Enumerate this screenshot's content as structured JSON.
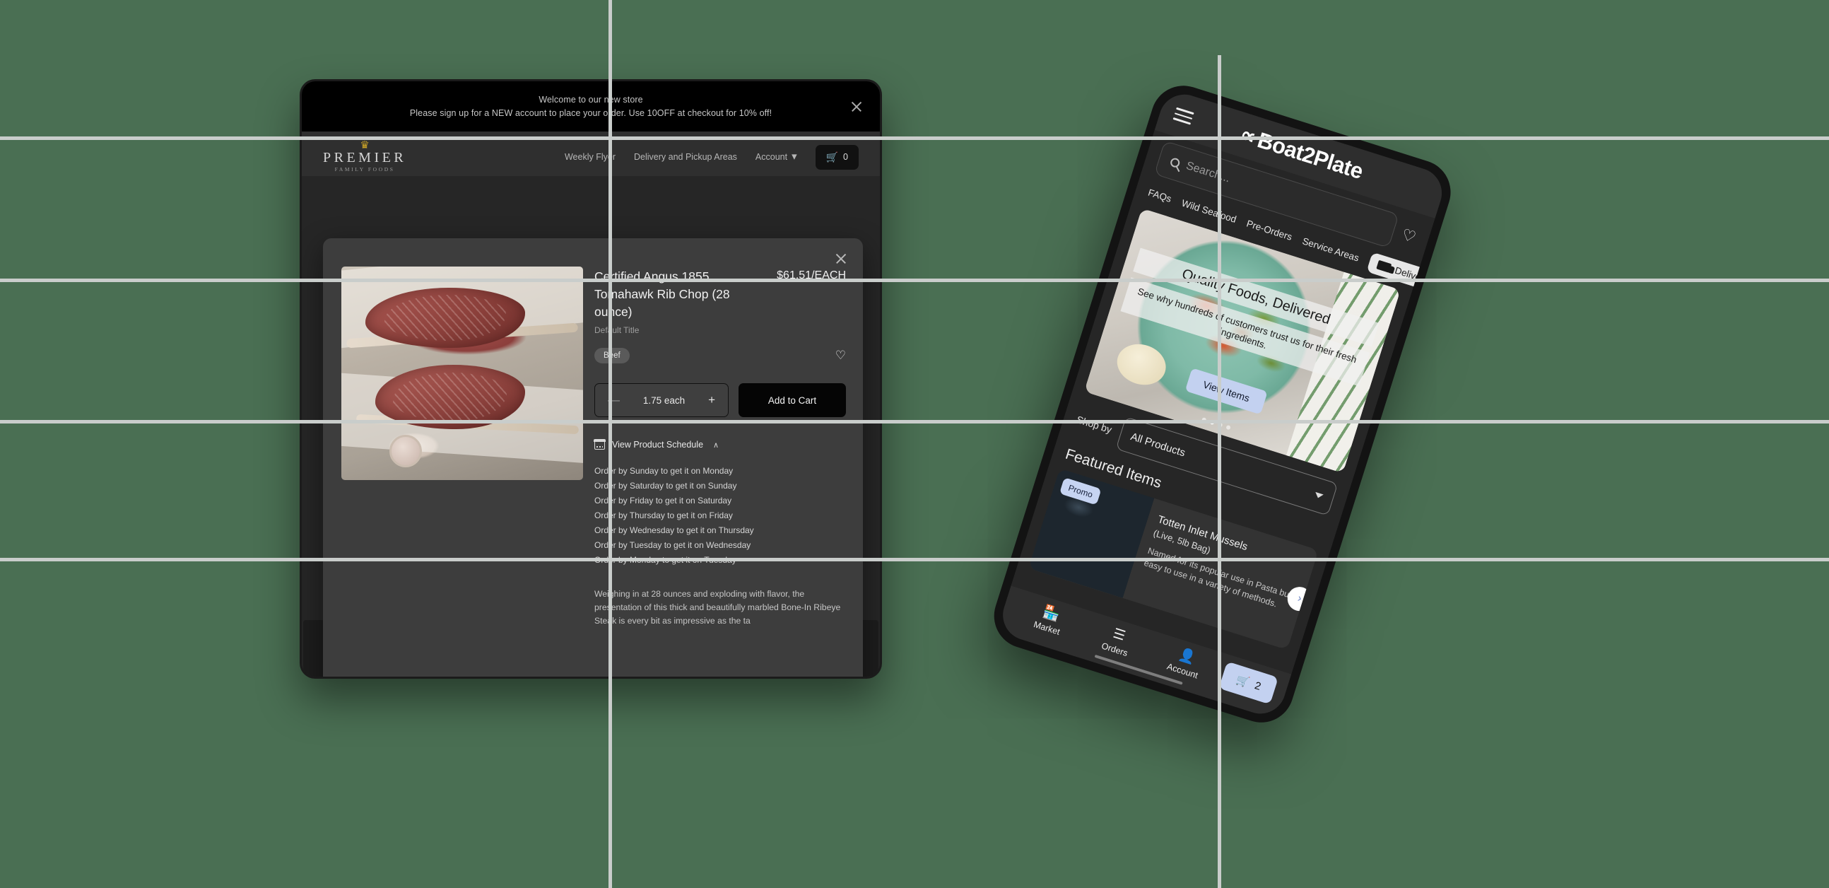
{
  "background": {
    "color": "#4a6f53",
    "guide_color": "#c9cdcb"
  },
  "desktop": {
    "announcement": {
      "line1": "Welcome to our new store",
      "line2": "Please sign up for a NEW account to place your order. Use 10OFF at checkout for 10% off!",
      "close_icon": "close-icon"
    },
    "brand": {
      "crown": "♛",
      "name": "PREMIER",
      "sub": "FAMILY FOODS"
    },
    "nav": {
      "links": [
        {
          "label": "Weekly Flyer"
        },
        {
          "label": "Delivery and Pickup Areas"
        }
      ],
      "account": {
        "label": "Account",
        "chevron": "⌄"
      },
      "cart": {
        "icon": "🛒",
        "count": "0"
      }
    },
    "modal": {
      "close_icon": "close-icon",
      "product": {
        "title": "Certified Angus 1855 Tomahawk Rib Chop (28 ounce)",
        "price": "$61.51/EACH",
        "variant": "Default Title",
        "tag": "Beef",
        "wishlist_icon": "♡",
        "quantity": {
          "minus": "—",
          "value": "1.75 each",
          "plus": "+"
        },
        "add_to_cart": "Add to Cart",
        "schedule_toggle": {
          "label": "View Product Schedule",
          "chevron": "∧"
        },
        "schedule": [
          "Order by Sunday to get it on Monday",
          "Order by Saturday to get it on Sunday",
          "Order by Friday to get it on Saturday",
          "Order by Thursday to get it on Friday",
          "Order by Wednesday to get it on Thursday",
          "Order by Tuesday to get it on Wednesday",
          "Order by Monday to get it on Tuesday"
        ],
        "description": "Weighing in at  28 ounces and exploding with flavor, the presentation of this thick and beautifully marbled Bone-In Ribeye Steak is every bit as impressive as the ta"
      }
    }
  },
  "phone": {
    "menu_icon": "hamburger-icon",
    "logo": {
      "glyph": "∝",
      "text": "Boat2Plate"
    },
    "search": {
      "placeholder": "Search...",
      "icon": "search-icon"
    },
    "wishlist_icon": "♡",
    "nav_links": [
      "FAQs",
      "Wild Seafood",
      "Pre-Orders",
      "Service Areas"
    ],
    "delivery_pill": {
      "label": "Delivery",
      "icon": "truck-icon"
    },
    "hero": {
      "title": "Quality Foods, Delivered",
      "subtitle": "See why hundreds of customers trust us for their fresh ingredients.",
      "cta": "View Items",
      "dots": 4,
      "active_dot": 1
    },
    "shop_by": {
      "label": "Shop by",
      "selected": "All Products"
    },
    "featured": {
      "heading": "Featured Items",
      "card": {
        "badge": "Promo",
        "name": "Totten Inlet Mussels",
        "sub": "(Live, 5lb Bag)",
        "description": "Named for its popular use in Pasta but easy to use in a variety of methods.",
        "next_icon": "›"
      }
    },
    "tabs": [
      {
        "label": "Market",
        "icon": "🏪"
      },
      {
        "label": "Orders",
        "icon": "☰"
      },
      {
        "label": "Account",
        "icon": "👤"
      }
    ],
    "cart_pill": {
      "icon": "🛒",
      "count": "2"
    }
  }
}
